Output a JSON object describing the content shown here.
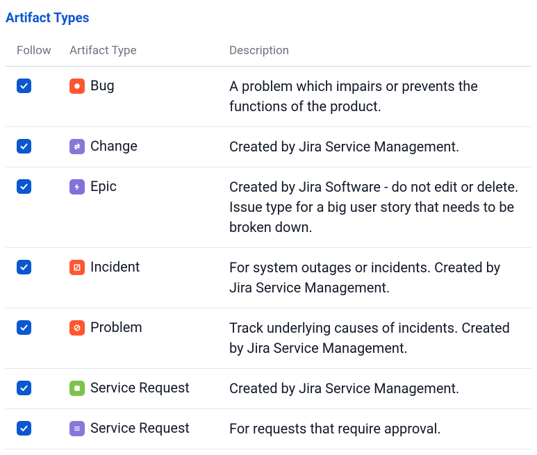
{
  "heading": "Artifact Types",
  "columns": {
    "follow": "Follow",
    "artifact_type": "Artifact Type",
    "description": "Description"
  },
  "rows": [
    {
      "followed": true,
      "icon": "bug-icon",
      "icon_class": "ic-bug",
      "name": "Bug",
      "description": "A problem which impairs or prevents the functions of the product."
    },
    {
      "followed": true,
      "icon": "change-icon",
      "icon_class": "ic-change",
      "name": "Change",
      "description": "Created by Jira Service Management."
    },
    {
      "followed": true,
      "icon": "epic-icon",
      "icon_class": "ic-epic",
      "name": "Epic",
      "description": "Created by Jira Software - do not edit or delete. Issue type for a big user story that needs to be broken down."
    },
    {
      "followed": true,
      "icon": "incident-icon",
      "icon_class": "ic-incident",
      "name": "Incident",
      "description": "For system outages or incidents. Created by Jira Service Management."
    },
    {
      "followed": true,
      "icon": "problem-icon",
      "icon_class": "ic-problem",
      "name": "Problem",
      "description": "Track underlying causes of incidents. Created by Jira Service Management."
    },
    {
      "followed": true,
      "icon": "service-request-icon",
      "icon_class": "ic-service",
      "name": "Service Request",
      "description": "Created by Jira Service Management."
    },
    {
      "followed": true,
      "icon": "service-request-approval-icon",
      "icon_class": "ic-approval",
      "name": "Service Request",
      "description": "For requests that require approval."
    }
  ]
}
